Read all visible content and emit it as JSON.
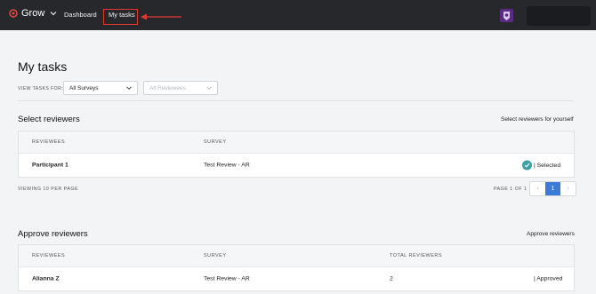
{
  "topbar": {
    "brand": "Grow",
    "nav": {
      "dashboard": "Dashboard",
      "my_tasks": "My tasks"
    }
  },
  "page": {
    "title": "My tasks",
    "filter_label": "VIEW TASKS FOR:",
    "survey_select": {
      "value": "All Surveys"
    },
    "reviewees_select": {
      "placeholder": "All Reviewees"
    }
  },
  "select_reviewers": {
    "title": "Select reviewers",
    "link": "Select reviewers for yourself",
    "columns": [
      "REVIEWEES",
      "SURVEY"
    ],
    "rows": [
      {
        "reviewee": "Participant 1",
        "survey": "Test Review - AR",
        "status": "| Selected"
      }
    ],
    "viewing": "VIEWING 10 PER PAGE",
    "page_of": "PAGE 1 OF 1",
    "pager": {
      "prev": "‹",
      "current": "1",
      "next": "›"
    }
  },
  "approve_reviewers": {
    "title": "Approve reviewers",
    "link": "Approve reviewers",
    "columns": [
      "REVIEWEES",
      "SURVEY",
      "TOTAL REVIEWERS"
    ],
    "rows": [
      {
        "reviewee": "Alianna Z",
        "survey": "Test Review - AR",
        "total": "2",
        "status": "| Approved"
      }
    ]
  },
  "colors": {
    "topbar": "#26282c",
    "highlight": "#e0372f",
    "accent": "#3a7bd5",
    "check": "#3aa0a8"
  }
}
